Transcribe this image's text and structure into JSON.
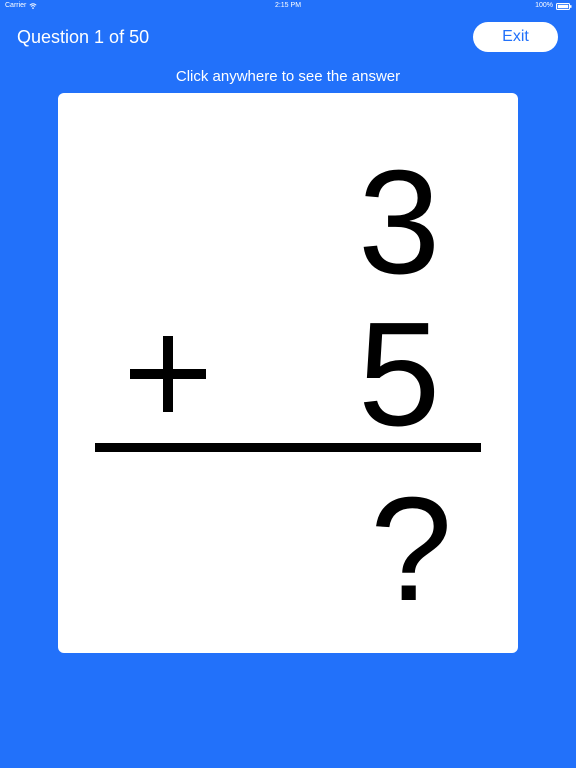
{
  "status_bar": {
    "carrier": "Carrier",
    "time": "2:15 PM",
    "battery": "100%"
  },
  "header": {
    "question_title": "Question 1 of 50",
    "exit_label": "Exit"
  },
  "hint": "Click anywhere to see the answer",
  "problem": {
    "top_number": "3",
    "operator": "+",
    "bottom_number": "5",
    "answer_placeholder": "?"
  },
  "colors": {
    "background": "#2271fa",
    "card": "#ffffff",
    "text": "#000000"
  },
  "icons": [
    "wifi-icon",
    "battery-icon",
    "plus-icon"
  ]
}
